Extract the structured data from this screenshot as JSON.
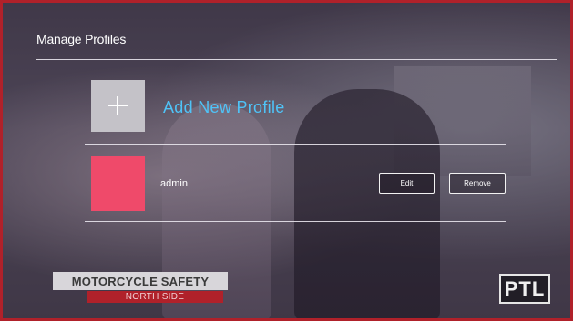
{
  "header": {
    "title": "Manage Profiles"
  },
  "add_profile": {
    "label": "Add New Profile",
    "icon": "plus-icon"
  },
  "profiles": [
    {
      "name": "admin",
      "avatar_color": "#ef4a6a",
      "edit_label": "Edit",
      "remove_label": "Remove"
    }
  ],
  "video_overlay": {
    "ticker_title": "MOTORCYCLE SAFETY",
    "ticker_subtitle": "NORTH SIDE",
    "logo_text": "PTL"
  },
  "colors": {
    "accent": "#4fc3f7",
    "border": "#b0212a",
    "add_tile": "#c4c2c8"
  }
}
